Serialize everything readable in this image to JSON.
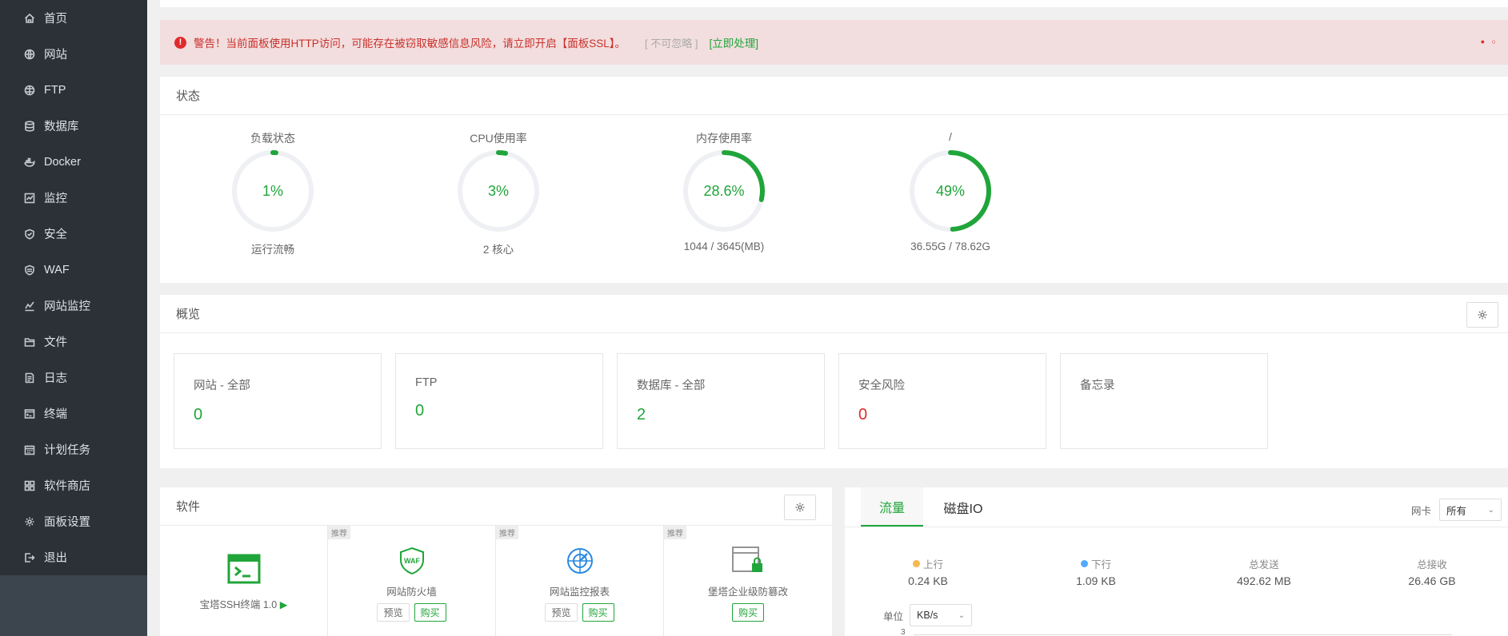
{
  "sidebar": {
    "items": [
      {
        "label": "首页",
        "icon": "home-icon",
        "active": true
      },
      {
        "label": "网站",
        "icon": "globe-icon"
      },
      {
        "label": "FTP",
        "icon": "ftp-icon"
      },
      {
        "label": "数据库",
        "icon": "database-icon"
      },
      {
        "label": "Docker",
        "icon": "docker-icon"
      },
      {
        "label": "监控",
        "icon": "monitor-icon"
      },
      {
        "label": "安全",
        "icon": "shield-icon"
      },
      {
        "label": "WAF",
        "icon": "waf-icon"
      },
      {
        "label": "网站监控",
        "icon": "chart-line-icon"
      },
      {
        "label": "文件",
        "icon": "folder-icon"
      },
      {
        "label": "日志",
        "icon": "log-icon"
      },
      {
        "label": "终端",
        "icon": "terminal-icon"
      },
      {
        "label": "计划任务",
        "icon": "calendar-icon"
      },
      {
        "label": "软件商店",
        "icon": "apps-icon"
      },
      {
        "label": "面板设置",
        "icon": "gear-icon"
      },
      {
        "label": "退出",
        "icon": "logout-icon"
      }
    ]
  },
  "alert": {
    "text": "警告！当前面板使用HTTP访问，可能存在被窃取敏感信息风险，请立即开启【面板SSL】。",
    "ignore": "[ 不可忽略 ]",
    "action": "[立即处理]",
    "colors": {
      "background": "#f2dede",
      "text": "#c9302c"
    }
  },
  "status": {
    "title": "状态",
    "gauges": [
      {
        "title": "负载状态",
        "value": 1,
        "display": "1%",
        "sub": "运行流畅"
      },
      {
        "title": "CPU使用率",
        "value": 3,
        "display": "3%",
        "sub": "2 核心"
      },
      {
        "title": "内存使用率",
        "value": 28.6,
        "display": "28.6%",
        "sub": "1044 / 3645(MB)"
      },
      {
        "title": "/",
        "value": 49,
        "display": "49%",
        "sub": "36.55G / 78.62G"
      }
    ],
    "colors": {
      "accent": "#20a53a",
      "track": "#eef0f3"
    }
  },
  "overview": {
    "title": "概览",
    "boxes": [
      {
        "label": "网站 - 全部",
        "value": "0"
      },
      {
        "label": "FTP",
        "value": "0"
      },
      {
        "label": "数据库 - 全部",
        "value": "2"
      },
      {
        "label": "安全风险",
        "value": "0",
        "danger": true
      },
      {
        "label": "备忘录",
        "value": ""
      }
    ]
  },
  "software": {
    "title": "软件",
    "items": [
      {
        "name": "宝塔SSH终端 1.0",
        "icon": "terminal-app-icon",
        "tag": ""
      },
      {
        "name": "网站防火墙",
        "icon": "waf-shield-icon",
        "tag": "推荐",
        "preview": "预览",
        "buy": "购买"
      },
      {
        "name": "网站监控报表",
        "icon": "radar-icon",
        "tag": "推荐",
        "preview": "预览",
        "buy": "购买"
      },
      {
        "name": "堡塔企业级防篡改",
        "icon": "lock-window-icon",
        "tag": "推荐",
        "buy": "购买"
      }
    ]
  },
  "traffic": {
    "tabs": [
      "流量",
      "磁盘IO"
    ],
    "nic_label": "网卡",
    "nic_value": "所有",
    "stats": [
      {
        "label": "上行",
        "value": "0.24 KB",
        "dot": "#f7b851"
      },
      {
        "label": "下行",
        "value": "1.09 KB",
        "dot": "#52a9ff"
      },
      {
        "label": "总发送",
        "value": "492.62 MB"
      },
      {
        "label": "总接收",
        "value": "26.46 GB"
      }
    ],
    "unit_label": "单位",
    "unit_value": "KB/s",
    "axis_tick": "3"
  }
}
